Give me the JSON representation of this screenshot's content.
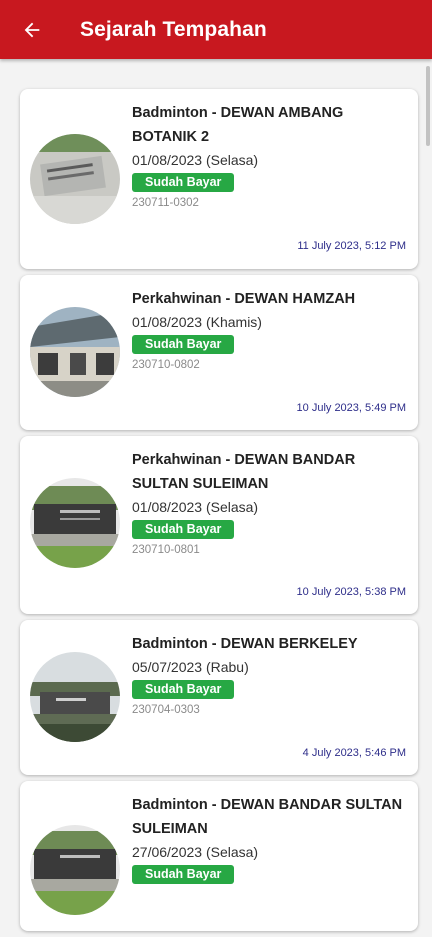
{
  "header": {
    "title": "Sejarah Tempahan",
    "back_icon": "arrow-left-icon",
    "color": "#c8181f"
  },
  "status_color": "#27a844",
  "bookings": [
    {
      "venue": "Badminton - DEWAN AMBANG BOTANIK 2",
      "date": "01/08/2023 (Selasa)",
      "status": "Sudah Bayar",
      "ref": "230711-0302",
      "timestamp": "11 July 2023, 5:12 PM"
    },
    {
      "venue": "Perkahwinan - DEWAN HAMZAH",
      "date": "01/08/2023 (Khamis)",
      "status": "Sudah Bayar",
      "ref": "230710-0802",
      "timestamp": "10 July 2023, 5:49 PM"
    },
    {
      "venue": "Perkahwinan - DEWAN BANDAR SULTAN SULEIMAN",
      "date": "01/08/2023 (Selasa)",
      "status": "Sudah Bayar",
      "ref": "230710-0801",
      "timestamp": "10 July 2023, 5:38 PM"
    },
    {
      "venue": "Badminton - DEWAN BERKELEY",
      "date": "05/07/2023 (Rabu)",
      "status": "Sudah Bayar",
      "ref": "230704-0303",
      "timestamp": "4 July 2023, 5:46 PM"
    },
    {
      "venue": "Badminton - DEWAN BANDAR SULTAN SULEIMAN",
      "date": "27/06/2023 (Selasa)",
      "status": "Sudah Bayar"
    }
  ]
}
